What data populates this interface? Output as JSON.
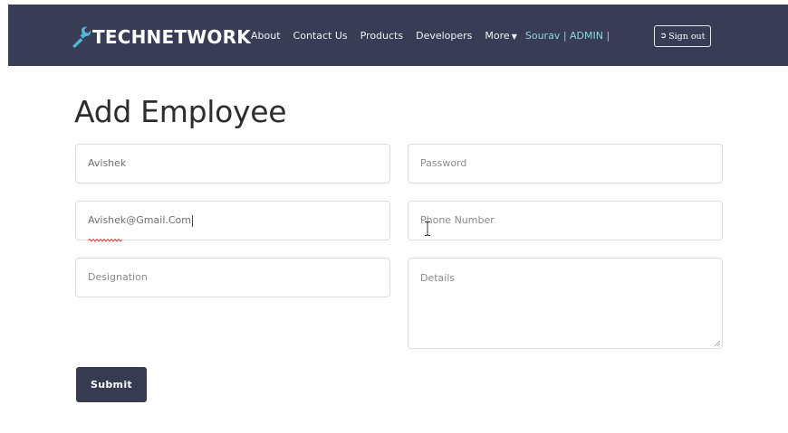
{
  "navbar": {
    "brand": "TECHNETWORK",
    "brand_icon": "wrench-icon",
    "links": {
      "about": "About",
      "contact": "Contact Us",
      "products": "Products",
      "developers": "Developers",
      "more": "More"
    },
    "user_label": "Sourav | ADMIN |",
    "signout_label": "Sign out",
    "signout_icon": "sign-out-icon"
  },
  "page": {
    "title": "Add Employee"
  },
  "form": {
    "name_value": "Avishek",
    "password_placeholder": "Password",
    "email_value": "Avishek@Gmail.Com",
    "phone_placeholder": "Phone Number",
    "designation_placeholder": "Designation",
    "details_placeholder": "Details",
    "submit_label": "Submit"
  },
  "colors": {
    "navbar_bg": "#383c54",
    "user_link": "#8fd4df",
    "brand_icon": "#4fb8d8",
    "submit_bg": "#373b52"
  }
}
